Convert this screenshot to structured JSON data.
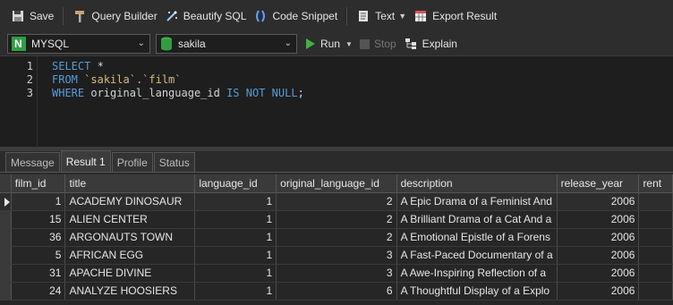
{
  "toolbar": {
    "save": "Save",
    "query_builder": "Query Builder",
    "beautify_sql": "Beautify SQL",
    "code_snippet": "Code Snippet",
    "text": "Text",
    "export_result": "Export Result"
  },
  "connection": {
    "type": "MYSQL",
    "database": "sakila",
    "run": "Run",
    "stop": "Stop",
    "explain": "Explain"
  },
  "editor": {
    "lines": [
      {
        "num": "1",
        "a": "SELECT",
        "b": " *",
        "c": ""
      },
      {
        "num": "2",
        "a": "FROM",
        "b": " ",
        "c": "`sakila`.`film`"
      },
      {
        "num": "3",
        "a": "WHERE",
        "b": " original_language_id ",
        "c": "IS NOT NULL",
        "d": ";"
      }
    ]
  },
  "tabs": [
    "Message",
    "Result 1",
    "Profile",
    "Status"
  ],
  "active_tab": 1,
  "grid": {
    "columns": [
      "film_id",
      "title",
      "language_id",
      "original_language_id",
      "description",
      "release_year",
      "rent"
    ],
    "rows": [
      [
        "1",
        "ACADEMY DINOSAUR",
        "1",
        "2",
        "A Epic Drama of a Feminist And",
        "2006",
        ""
      ],
      [
        "15",
        "ALIEN CENTER",
        "1",
        "2",
        "A Brilliant Drama of a Cat And a",
        "2006",
        ""
      ],
      [
        "36",
        "ARGONAUTS TOWN",
        "1",
        "2",
        "A Emotional Epistle of a Forens",
        "2006",
        ""
      ],
      [
        "5",
        "AFRICAN EGG",
        "1",
        "3",
        "A Fast-Paced Documentary of a",
        "2006",
        ""
      ],
      [
        "31",
        "APACHE DIVINE",
        "1",
        "3",
        "A Awe-Inspiring Reflection of a",
        "2006",
        ""
      ],
      [
        "24",
        "ANALYZE HOOSIERS",
        "1",
        "6",
        "A Thoughtful Display of a Explo",
        "2006",
        ""
      ]
    ]
  },
  "colors": {
    "keyword": "#569cd6",
    "string": "#d7ba7d",
    "run_green": "#3fb33f"
  }
}
